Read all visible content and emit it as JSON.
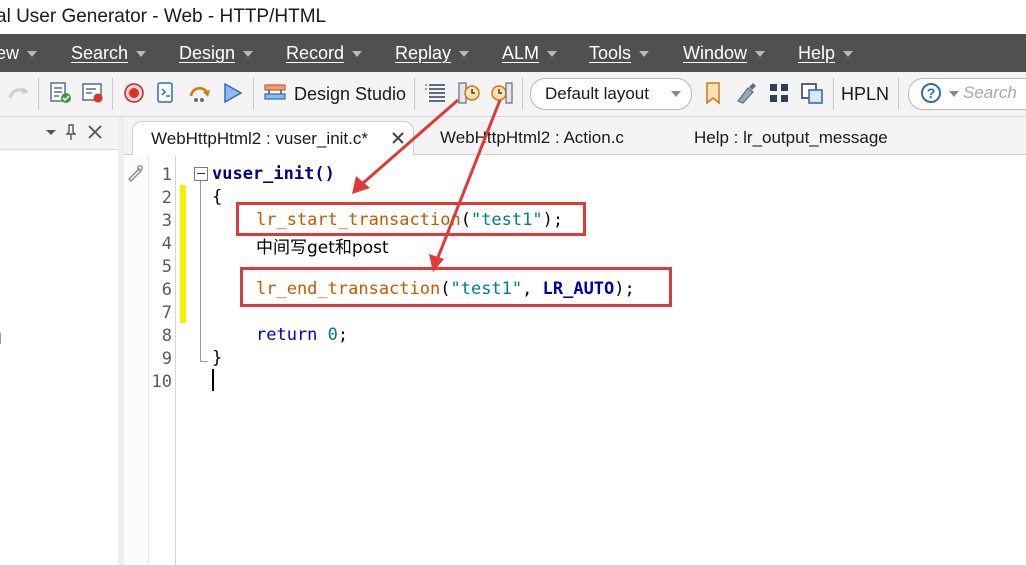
{
  "window": {
    "title": "al User Generator - Web - HTTP/HTML"
  },
  "menu": [
    {
      "label": "ew"
    },
    {
      "label": "Search"
    },
    {
      "label": "Design"
    },
    {
      "label": "Record"
    },
    {
      "label": "Replay"
    },
    {
      "label": "ALM"
    },
    {
      "label": "Tools"
    },
    {
      "label": "Window"
    },
    {
      "label": "Help"
    }
  ],
  "toolbar": {
    "design_studio": "Design Studio",
    "layout_value": "Default layout",
    "hpln": "HPLN",
    "search_placeholder": "Search",
    "help_symbol": "?"
  },
  "left_panel": {
    "stub_text": "l"
  },
  "tabs": [
    {
      "label": "WebHttpHtml2 : vuser_init.c*",
      "active": true
    },
    {
      "label": "WebHttpHtml2 : Action.c",
      "active": false
    },
    {
      "label": "Help : lr_output_message",
      "active": false
    }
  ],
  "editor": {
    "line_numbers": [
      "1",
      "2",
      "3",
      "4",
      "5",
      "6",
      "7",
      "8",
      "9",
      "10"
    ],
    "code": {
      "l1_fn": "vuser_init()",
      "l2": "{",
      "l3_fn": "lr_start_transaction",
      "l3_open": "(",
      "l3_str": "\"test1\"",
      "l3_close": ");",
      "l4_text": "中间写get和post",
      "l6_fn": "lr_end_transaction",
      "l6_open": "(",
      "l6_str": "\"test1\"",
      "l6_comma": ", ",
      "l6_const": "LR_AUTO",
      "l6_close": ");",
      "l8_kw": "return",
      "l8_space": " ",
      "l8_num": "0",
      "l8_semi": ";",
      "l9": "}"
    }
  },
  "colors": {
    "menubar_bg": "#505050",
    "annotation_red": "#e0393b",
    "change_marker": "#f5f200",
    "function_color": "#c25a00",
    "string_color": "#007f7f",
    "keyword_color": "#0000cc"
  }
}
